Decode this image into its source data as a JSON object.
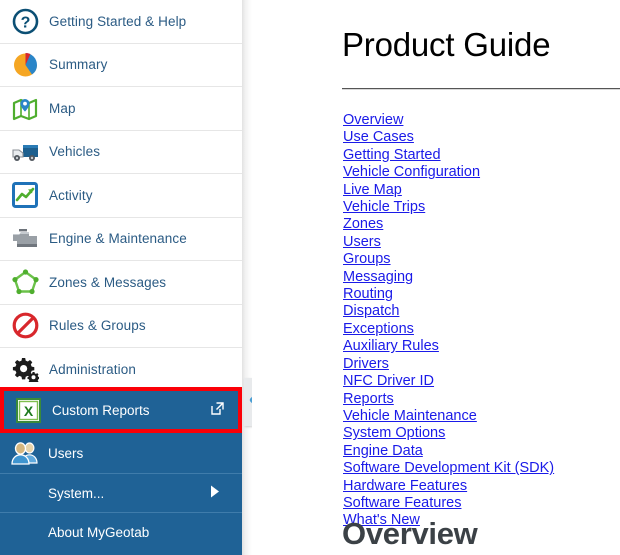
{
  "sidebar": {
    "items": [
      {
        "label": "Getting Started & Help",
        "icon": "question-circle-icon"
      },
      {
        "label": "Summary",
        "icon": "pie-chart-icon"
      },
      {
        "label": "Map",
        "icon": "map-pin-icon"
      },
      {
        "label": "Vehicles",
        "icon": "truck-icon"
      },
      {
        "label": "Activity",
        "icon": "activity-chart-icon"
      },
      {
        "label": "Engine & Maintenance",
        "icon": "engine-icon"
      },
      {
        "label": "Zones & Messages",
        "icon": "zone-polygon-icon"
      },
      {
        "label": "Rules & Groups",
        "icon": "prohibition-icon"
      },
      {
        "label": "Administration",
        "icon": "gear-icon"
      }
    ]
  },
  "submenu": {
    "custom_reports": {
      "label": "Custom Reports",
      "icon": "excel-icon",
      "external_icon": "external-link-icon",
      "highlight_color": "#fb0007",
      "selected": true
    },
    "users": {
      "label": "Users",
      "icon": "users-icon"
    },
    "system": {
      "label": "System...",
      "arrow_icon": "caret-right-icon"
    },
    "about": {
      "label": "About MyGeotab"
    },
    "panel_color": "#1f6296"
  },
  "collapse_handle": {
    "icon": "chevron-left-icon",
    "color": "#4a9ed4"
  },
  "content": {
    "title": "Product Guide",
    "links": [
      "Overview",
      "Use Cases",
      "Getting Started",
      "Vehicle Configuration",
      "Live Map",
      "Vehicle Trips",
      "Zones",
      "Users",
      "Groups",
      "Messaging",
      "Routing",
      "Dispatch",
      "Exceptions",
      "Auxiliary Rules",
      "Drivers",
      "NFC Driver ID",
      "Reports",
      "Vehicle Maintenance",
      "System Options",
      "Engine Data",
      "Software Development Kit (SDK)",
      "Hardware Features",
      "Software Features",
      "What's New"
    ],
    "link_color": "#1a1ae8",
    "section_heading": "Overview"
  }
}
